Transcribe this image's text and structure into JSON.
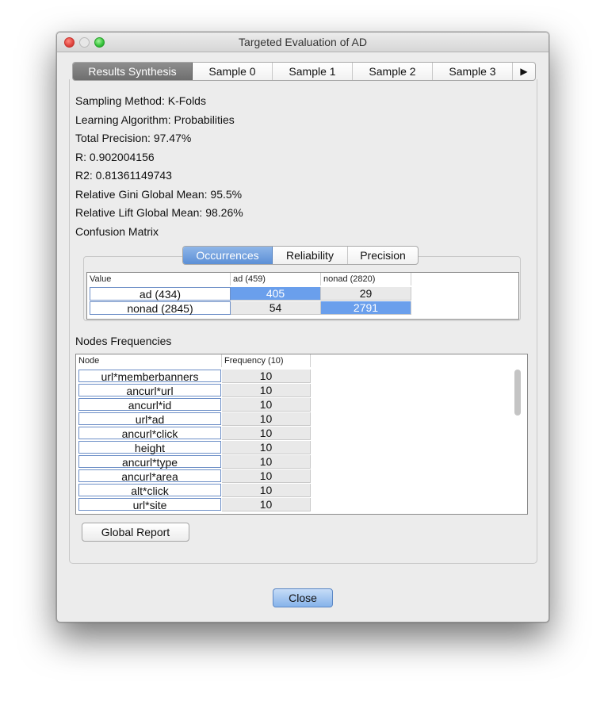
{
  "window": {
    "title": "Targeted Evaluation of  AD"
  },
  "tabs": [
    "Results Synthesis",
    "Sample 0",
    "Sample 1",
    "Sample 2",
    "Sample 3"
  ],
  "tab_scroll_icon": "right-triangle-arrow",
  "info": {
    "sampling_method": "Sampling Method: K-Folds",
    "learning_algorithm": "Learning Algorithm: Probabilities",
    "total_precision": "Total Precision: 97.47%",
    "r": "R: 0.902004156",
    "r2": "R2: 0.81361149743",
    "gini": "Relative Gini Global Mean: 95.5%",
    "lift": "Relative Lift Global Mean: 98.26%",
    "confusion_label": "Confusion Matrix"
  },
  "matrix_view": {
    "options": [
      "Occurrences",
      "Reliability",
      "Precision"
    ],
    "selected": "Occurrences"
  },
  "confusion": {
    "headers": [
      "Value",
      "ad (459)",
      "nonad (2820)"
    ],
    "rows": [
      {
        "label": "ad (434)",
        "values": [
          "405",
          "29"
        ]
      },
      {
        "label": "nonad (2845)",
        "values": [
          "54",
          "2791"
        ]
      }
    ]
  },
  "nodes": {
    "label": "Nodes Frequencies",
    "headers": [
      "Node",
      "Frequency (10)"
    ],
    "rows": [
      {
        "node": "url*memberbanners",
        "freq": "10"
      },
      {
        "node": "ancurl*url",
        "freq": "10"
      },
      {
        "node": "ancurl*id",
        "freq": "10"
      },
      {
        "node": "url*ad",
        "freq": "10"
      },
      {
        "node": "ancurl*click",
        "freq": "10"
      },
      {
        "node": "height",
        "freq": "10"
      },
      {
        "node": "ancurl*type",
        "freq": "10"
      },
      {
        "node": "ancurl*area",
        "freq": "10"
      },
      {
        "node": "alt*click",
        "freq": "10"
      },
      {
        "node": "url*site",
        "freq": "10"
      }
    ]
  },
  "buttons": {
    "global_report": "Global Report",
    "close": "Close"
  }
}
